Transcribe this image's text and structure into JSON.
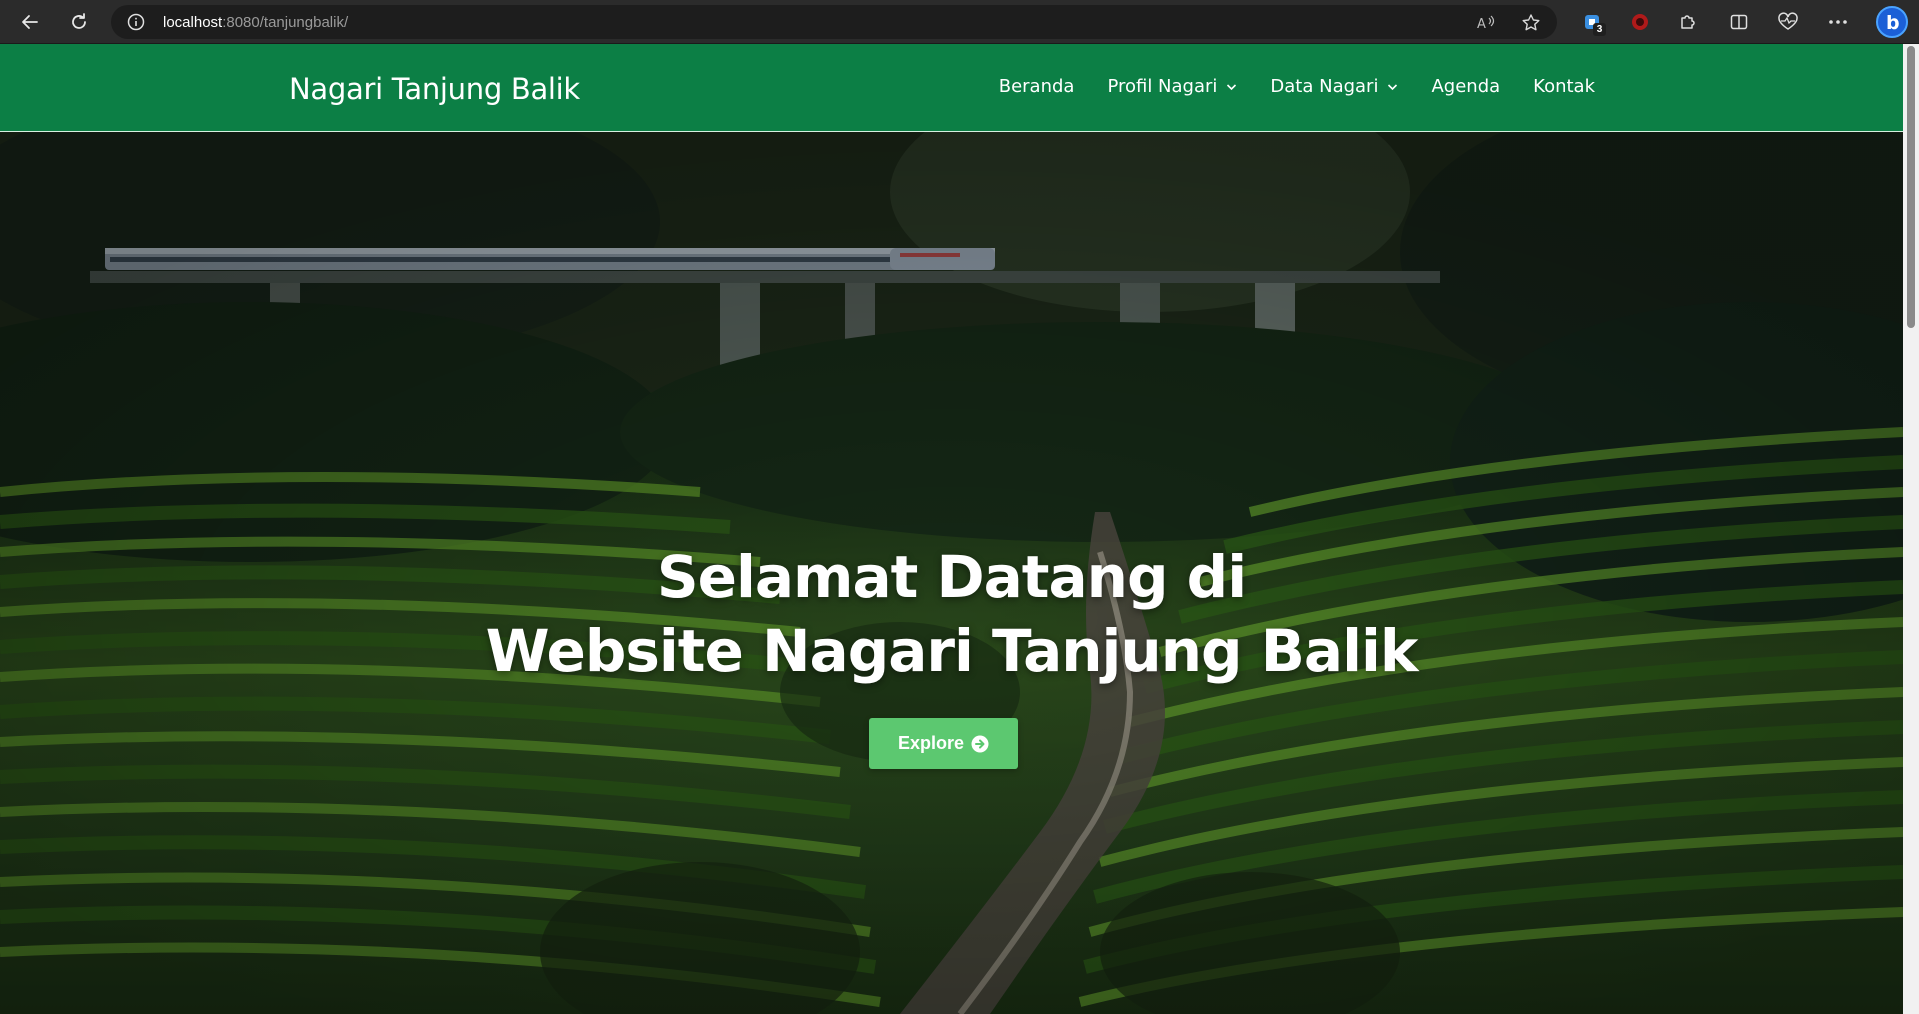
{
  "browser": {
    "url_host": "localhost",
    "url_rest": ":8080/tanjungbalik/",
    "extension_badge": "3"
  },
  "site": {
    "brand": "Nagari Tanjung Balik",
    "menu": [
      {
        "label": "Beranda",
        "dropdown": false
      },
      {
        "label": "Profil Nagari",
        "dropdown": true
      },
      {
        "label": "Data Nagari",
        "dropdown": true
      },
      {
        "label": "Agenda",
        "dropdown": false
      },
      {
        "label": "Kontak",
        "dropdown": false
      }
    ],
    "colors": {
      "navbar": "#0c7f45",
      "button": "#5cc870"
    }
  },
  "hero": {
    "title_line1": "Selamat Datang di",
    "title_line2": "Website Nagari Tanjung Balik",
    "button_label": "Explore"
  }
}
